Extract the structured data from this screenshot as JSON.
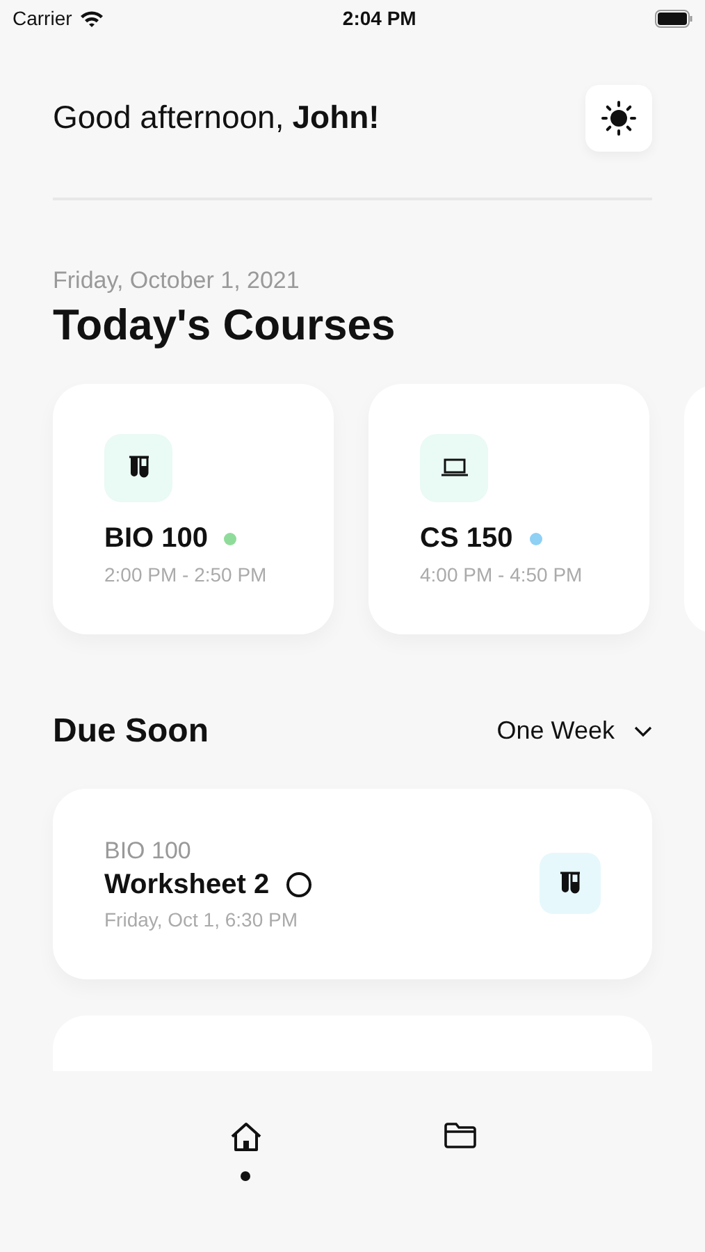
{
  "status_bar": {
    "carrier": "Carrier",
    "time": "2:04 PM"
  },
  "greeting": {
    "text": "Good afternoon,",
    "name": "John!"
  },
  "date": "Friday, October 1, 2021",
  "title": "Today's Courses",
  "courses": [
    {
      "code": "BIO 100",
      "time": "2:00 PM - 2:50 PM",
      "kind": "flask",
      "color": "#8fdc9a"
    },
    {
      "code": "CS 150",
      "time": "4:00 PM - 4:50 PM",
      "kind": "laptop",
      "color": "#8fd0f5"
    }
  ],
  "due_soon": {
    "title": "Due Soon",
    "filter": "One Week",
    "items": [
      {
        "course": "BIO 100",
        "title": "Worksheet 2",
        "checked": false,
        "due": "Friday, Oct 1, 6:30 PM",
        "kind": "flask"
      }
    ]
  },
  "tab_bar": [
    {
      "kind": "home",
      "selected": true
    },
    {
      "kind": "folder",
      "selected": false
    }
  ]
}
